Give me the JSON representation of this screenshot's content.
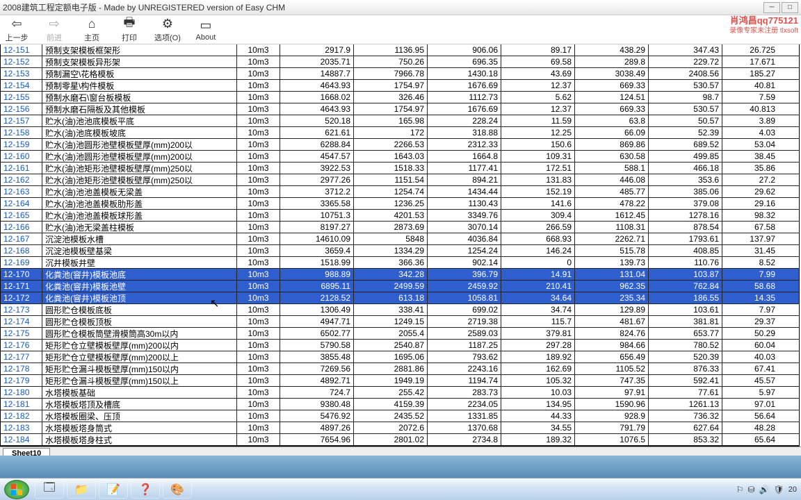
{
  "window": {
    "title": "2008建筑工程定额电子版 - Made by UNREGISTERED version of Easy CHM"
  },
  "toolbar": {
    "back": "上一步",
    "forward": "前进",
    "home": "主页",
    "print": "打印",
    "options": "选项(O)",
    "about": "About"
  },
  "watermark": {
    "line1": "肖鸿昌qq775121",
    "line2": "录像专家未注册 tlxsoft"
  },
  "sheet_tab": "Sheet10",
  "tray": {
    "time": "20"
  },
  "selected_rows": [
    "12-170",
    "12-171",
    "12-172"
  ],
  "chart_data": {
    "type": "table",
    "columns": [
      "code",
      "name",
      "unit",
      "v1",
      "v2",
      "v3",
      "v4",
      "v5",
      "v6",
      "v7"
    ],
    "rows": [
      [
        "12-151",
        "预制支架模板框架形",
        "10m3",
        "2917.9",
        "1136.95",
        "906.06",
        "89.17",
        "438.29",
        "347.43",
        "26.725"
      ],
      [
        "12-152",
        "预制支架模板异形架",
        "10m3",
        "2035.71",
        "750.26",
        "696.35",
        "69.58",
        "289.8",
        "229.72",
        "17.671"
      ],
      [
        "12-153",
        "预制漏空\\花格模板",
        "10m3",
        "14887.7",
        "7966.78",
        "1430.18",
        "43.69",
        "3038.49",
        "2408.56",
        "185.27"
      ],
      [
        "12-154",
        "预制零星\\构件模板",
        "10m3",
        "4643.93",
        "1754.97",
        "1676.69",
        "12.37",
        "669.33",
        "530.57",
        "40.81"
      ],
      [
        "12-155",
        "预制水磨石\\窗台板模板",
        "10m3",
        "1668.02",
        "326.46",
        "1112.73",
        "5.62",
        "124.51",
        "98.7",
        "7.59"
      ],
      [
        "12-156",
        "预制水磨石隔板及其他模板",
        "10m3",
        "4643.93",
        "1754.97",
        "1676.69",
        "12.37",
        "669.33",
        "530.57",
        "40.813"
      ],
      [
        "12-157",
        "贮水(油)池池底模板平底",
        "10m3",
        "520.18",
        "165.98",
        "228.24",
        "11.59",
        "63.8",
        "50.57",
        "3.89"
      ],
      [
        "12-158",
        "贮水(油)池底模板坡底",
        "10m3",
        "621.61",
        "172",
        "318.88",
        "12.25",
        "66.09",
        "52.39",
        "4.03"
      ],
      [
        "12-159",
        "贮水(油)池圆形池壁模板壁厚(mm)200以",
        "10m3",
        "6288.84",
        "2266.53",
        "2312.33",
        "150.6",
        "869.86",
        "689.52",
        "53.04"
      ],
      [
        "12-160",
        "贮水(油)池圆形池壁模板壁厚(mm)200以",
        "10m3",
        "4547.57",
        "1643.03",
        "1664.8",
        "109.31",
        "630.58",
        "499.85",
        "38.45"
      ],
      [
        "12-161",
        "贮水(油)池矩形池壁模板壁厚(mm)250以",
        "10m3",
        "3922.53",
        "1518.33",
        "1177.41",
        "172.51",
        "588.1",
        "466.18",
        "35.86"
      ],
      [
        "12-162",
        "贮水(油)池矩形池壁模板壁厚(mm)250以",
        "10m3",
        "2977.26",
        "1151.54",
        "894.21",
        "131.83",
        "446.08",
        "353.6",
        "27.2"
      ],
      [
        "12-163",
        "贮水(油)池池盖模板无梁盖",
        "10m3",
        "3712.2",
        "1254.74",
        "1434.44",
        "152.19",
        "485.77",
        "385.06",
        "29.62"
      ],
      [
        "12-164",
        "贮水(油)池池盖模板肋形盖",
        "10m3",
        "3365.58",
        "1236.25",
        "1130.43",
        "141.6",
        "478.22",
        "379.08",
        "29.16"
      ],
      [
        "12-165",
        "贮水(油)池池盖模板球形盖",
        "10m3",
        "10751.3",
        "4201.53",
        "3349.76",
        "309.4",
        "1612.45",
        "1278.16",
        "98.32"
      ],
      [
        "12-166",
        "贮水(油)池无梁盖柱模板",
        "10m3",
        "8197.27",
        "2873.69",
        "3070.14",
        "266.59",
        "1108.31",
        "878.54",
        "67.58"
      ],
      [
        "12-167",
        "沉淀池模板水槽",
        "10m3",
        "14610.09",
        "5848",
        "4036.84",
        "668.93",
        "2262.71",
        "1793.61",
        "137.97"
      ],
      [
        "12-168",
        "沉淀池模板壁基梁",
        "10m3",
        "3659.4",
        "1334.29",
        "1254.24",
        "146.24",
        "515.78",
        "408.85",
        "31.45"
      ],
      [
        "12-169",
        "沉井模板井壁",
        "10m3",
        "1518.99",
        "366.36",
        "902.14",
        "0",
        "139.73",
        "110.76",
        "8.52"
      ],
      [
        "12-170",
        "化粪池(窨井)模板池底",
        "10m3",
        "988.89",
        "342.28",
        "396.79",
        "14.91",
        "131.04",
        "103.87",
        "7.99"
      ],
      [
        "12-171",
        "化粪池(窨井)模板池壁",
        "10m3",
        "6895.11",
        "2499.59",
        "2459.92",
        "210.41",
        "962.35",
        "762.84",
        "58.68"
      ],
      [
        "12-172",
        "化粪池(窨井)模板池顶",
        "10m3",
        "2128.52",
        "613.18",
        "1058.81",
        "34.64",
        "235.34",
        "186.55",
        "14.35"
      ],
      [
        "12-173",
        "圆形贮仓模板底板",
        "10m3",
        "1306.49",
        "338.41",
        "699.02",
        "34.74",
        "129.89",
        "103.61",
        "7.97"
      ],
      [
        "12-174",
        "圆形贮仓模板顶板",
        "10m3",
        "4947.71",
        "1249.15",
        "2719.38",
        "115.7",
        "481.67",
        "381.81",
        "29.37"
      ],
      [
        "12-175",
        "圆形贮仓模板筒壁滑模筒高30m以内",
        "10m3",
        "6502.77",
        "2055.4",
        "2589.03",
        "379.81",
        "824.76",
        "653.77",
        "50.29"
      ],
      [
        "12-176",
        "矩形贮仓立壁模板壁厚(mm)200以内",
        "10m3",
        "5790.58",
        "2540.87",
        "1187.25",
        "297.28",
        "984.66",
        "780.52",
        "60.04"
      ],
      [
        "12-177",
        "矩形贮仓立壁模板壁厚(mm)200以上",
        "10m3",
        "3855.48",
        "1695.06",
        "793.62",
        "189.92",
        "656.49",
        "520.39",
        "40.03"
      ],
      [
        "12-178",
        "矩形贮仓漏斗模板壁厚(mm)150以内",
        "10m3",
        "7269.56",
        "2881.86",
        "2243.16",
        "162.69",
        "1105.52",
        "876.33",
        "67.41"
      ],
      [
        "12-179",
        "矩形贮仓漏斗模板壁厚(mm)150以上",
        "10m3",
        "4892.71",
        "1949.19",
        "1194.74",
        "105.32",
        "747.35",
        "592.41",
        "45.57"
      ],
      [
        "12-180",
        "水塔模板基础",
        "10m3",
        "724.7",
        "255.42",
        "283.73",
        "10.03",
        "97.91",
        "77.61",
        "5.97"
      ],
      [
        "12-181",
        "水塔模板塔顶及槽底",
        "10m3",
        "9380.48",
        "4159.39",
        "2234.05",
        "134.95",
        "1590.96",
        "1261.13",
        "97.01"
      ],
      [
        "12-182",
        "水塔模板圈梁、压顶",
        "10m3",
        "5476.92",
        "2435.52",
        "1331.85",
        "44.33",
        "928.9",
        "736.32",
        "56.64"
      ],
      [
        "12-183",
        "水塔模板塔身筒式",
        "10m3",
        "4897.26",
        "2072.6",
        "1370.68",
        "34.55",
        "791.79",
        "627.64",
        "48.28"
      ],
      [
        "12-184",
        "水塔模板塔身柱式",
        "10m3",
        "7654.96",
        "2801.02",
        "2734.8",
        "189.32",
        "1076.5",
        "853.32",
        "65.64"
      ]
    ]
  }
}
